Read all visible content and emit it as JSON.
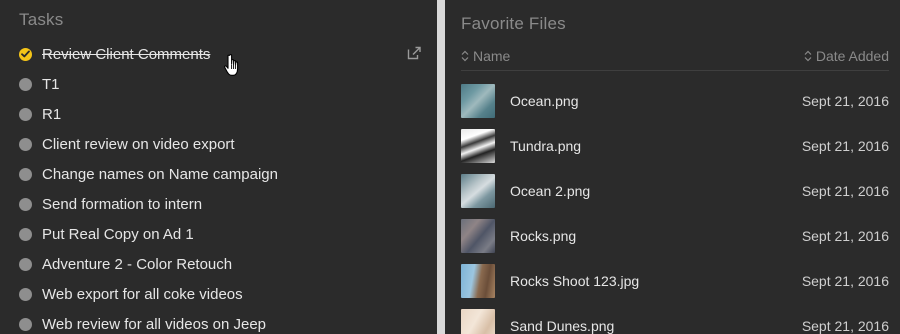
{
  "tasks_panel": {
    "title": "Tasks",
    "tasks": [
      {
        "label": "Review Client Comments",
        "done": true
      },
      {
        "label": "T1",
        "done": false
      },
      {
        "label": "R1",
        "done": false
      },
      {
        "label": "Client review on video export",
        "done": false
      },
      {
        "label": "Change names on Name campaign",
        "done": false
      },
      {
        "label": "Send formation to intern",
        "done": false
      },
      {
        "label": "Put Real Copy on Ad 1",
        "done": false
      },
      {
        "label": "Adventure 2 - Color Retouch",
        "done": false
      },
      {
        "label": "Web export for all coke videos",
        "done": false
      },
      {
        "label": "Web review for all videos on Jeep",
        "done": false
      }
    ],
    "icons": {
      "check": "check-icon",
      "share": "external-link-icon",
      "cursor": "hand-pointer-cursor"
    },
    "colors": {
      "done": "#f5c518",
      "pending": "#8e8e8e"
    }
  },
  "files_panel": {
    "title": "Favorite Files",
    "columns": {
      "name": "Name",
      "date": "Date Added"
    },
    "files": [
      {
        "name": "Ocean.png",
        "date": "Sept 21, 2016",
        "thumb": "ocean"
      },
      {
        "name": "Tundra.png",
        "date": "Sept 21, 2016",
        "thumb": "tundra"
      },
      {
        "name": "Ocean 2.png",
        "date": "Sept 21, 2016",
        "thumb": "ocean2"
      },
      {
        "name": "Rocks.png",
        "date": "Sept 21, 2016",
        "thumb": "rocks"
      },
      {
        "name": "Rocks Shoot 123.jpg",
        "date": "Sept 21, 2016",
        "thumb": "rockshoot"
      },
      {
        "name": "Sand Dunes.png",
        "date": "Sept 21, 2016",
        "thumb": "dunes"
      }
    ]
  }
}
